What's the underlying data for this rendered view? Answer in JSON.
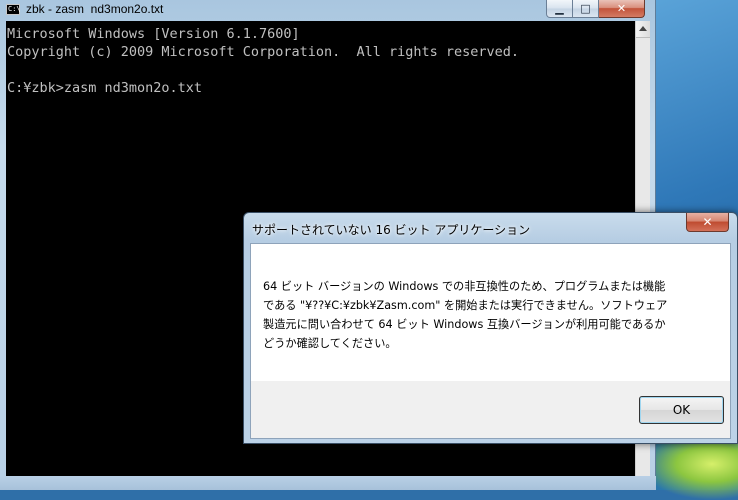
{
  "console": {
    "title": "zbk - zasm  nd3mon2o.txt",
    "icon_text": "C:\\",
    "lines": [
      "Microsoft Windows [Version 6.1.7600]",
      "Copyright (c) 2009 Microsoft Corporation.  All rights reserved.",
      "",
      "C:¥zbk>zasm nd3mon2o.txt"
    ],
    "buttons": {
      "minimize": "▁",
      "maximize": "□",
      "close": "✕"
    }
  },
  "dialog": {
    "title": "サポートされていない 16 ビット アプリケーション",
    "close_label": "✕",
    "message_lines": [
      "64 ビット バージョンの Windows での非互換性のため、プログラムまたは機能",
      "である \"¥??¥C:¥zbk¥Zasm.com\" を開始または実行できません。ソフトウェア",
      "製造元に問い合わせて 64 ビット Windows 互換バージョンが利用可能であるか",
      "どうか確認してください。"
    ],
    "ok_label": "OK"
  },
  "colors": {
    "console_bg": "#000000",
    "console_text": "#c0c0c0",
    "close_red": "#c2533a"
  }
}
